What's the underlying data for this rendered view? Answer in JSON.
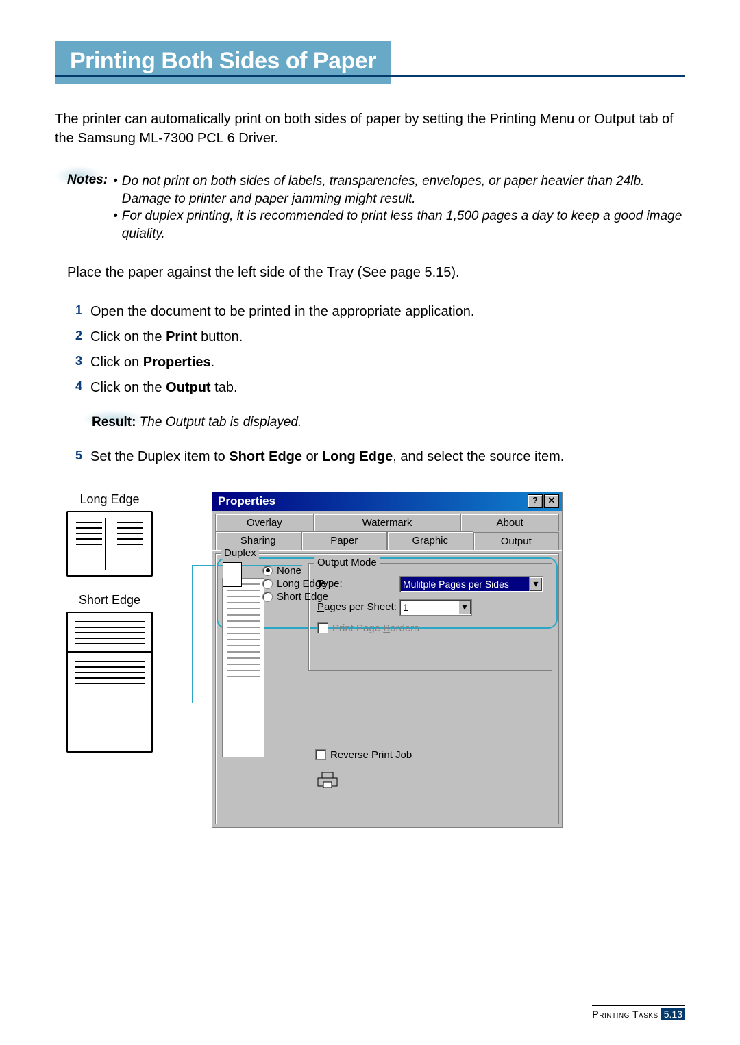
{
  "title": "Printing Both Sides of Paper",
  "chapter_number": "5",
  "intro": "The printer can automatically print on both sides of paper by setting the Printing Menu or Output tab of the Samsung ML-7300 PCL 6 Driver.",
  "notes_label": "Notes:",
  "notes": [
    "Do not print on both sides of labels, transparencies, envelopes, or paper heavier than 24lb. Damage to printer and paper jamming might result.",
    "For duplex printing, it is recommended to print less than 1,500 pages a day to keep a good image quiality."
  ],
  "place_paper": "Place the paper against the left side of the Tray (See page 5.15).",
  "steps": {
    "s1": "Open the document to be printed in the appropriate application.",
    "s2_pre": "Click on the ",
    "s2_kw": "Print",
    "s2_post": " button.",
    "s3_pre": "Click on ",
    "s3_kw": "Properties",
    "s3_post": ".",
    "s4_pre": "Click on the ",
    "s4_kw": "Output",
    "s4_post": " tab.",
    "s5_pre": "Set the Duplex item to ",
    "s5_kw1": "Short Edge",
    "s5_mid": " or ",
    "s5_kw2": "Long Edge",
    "s5_post": ", and select the source item."
  },
  "result_label": "Result:",
  "result_text": " The Output tab is displayed.",
  "edge_labels": {
    "long": "Long Edge",
    "short": "Short Edge"
  },
  "dialog": {
    "title": "Properties",
    "help_btn": "?",
    "close_btn": "✕",
    "tabs_row1": [
      "Overlay",
      "Watermark",
      "About"
    ],
    "tabs_row2": [
      "Sharing",
      "Paper",
      "Graphic",
      "Output"
    ],
    "output_mode_legend": "Output Mode",
    "type_label_pre": "T",
    "type_label_ul": "y",
    "type_label_post": "pe:",
    "type_value": "Mulitple Pages per Sides",
    "pages_label_ul": "P",
    "pages_label_post": "ages per Sheet:",
    "pages_value": "1",
    "borders_label_pre": "Print Page ",
    "borders_label_ul": "B",
    "borders_label_post": "orders",
    "duplex_legend": "Duplex",
    "duplex_none_ul": "N",
    "duplex_none_post": "one",
    "duplex_long_ul": "L",
    "duplex_long_post": "ong Edge",
    "duplex_short_pre": "S",
    "duplex_short_ul": "h",
    "duplex_short_post": "ort Edge",
    "reverse_ul": "R",
    "reverse_post": "everse Print Job"
  },
  "footer": {
    "label": "Printing Tasks",
    "chapter": "5",
    "dot": ".",
    "page": "13"
  }
}
